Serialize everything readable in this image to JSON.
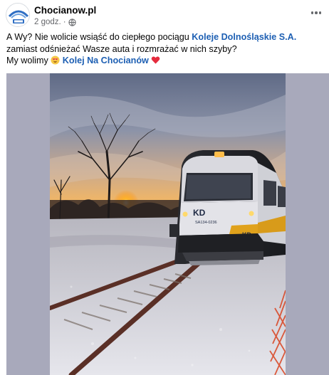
{
  "post": {
    "page_name": "Chocianow.pl",
    "time": "2 godz.",
    "separator": "·",
    "icons": {
      "avatar": "chocianow-logo-icon",
      "privacy": "globe-icon",
      "more": "more-options-icon",
      "heart_eyes": "heart-eyes-emoji-icon",
      "heart": "red-heart-emoji-icon"
    },
    "text": {
      "line1_a": "A Wy? Nie wolicie wsiąść do ciepłego pociągu ",
      "line1_link": "Koleje Dolnośląskie S.A.",
      "line1_b": " zamiast odśnieżać Wasze auta i rozmrażać w nich szyby?",
      "line2_a": "My wolimy ",
      "line2_link": "Kolej Na Chocianów"
    },
    "photo": {
      "train_logo": "KD",
      "train_number": "SA134-0236"
    },
    "colors": {
      "link": "#1d5fb3",
      "meta": "#65676b",
      "frame_bg": "#a8a9bb"
    }
  }
}
